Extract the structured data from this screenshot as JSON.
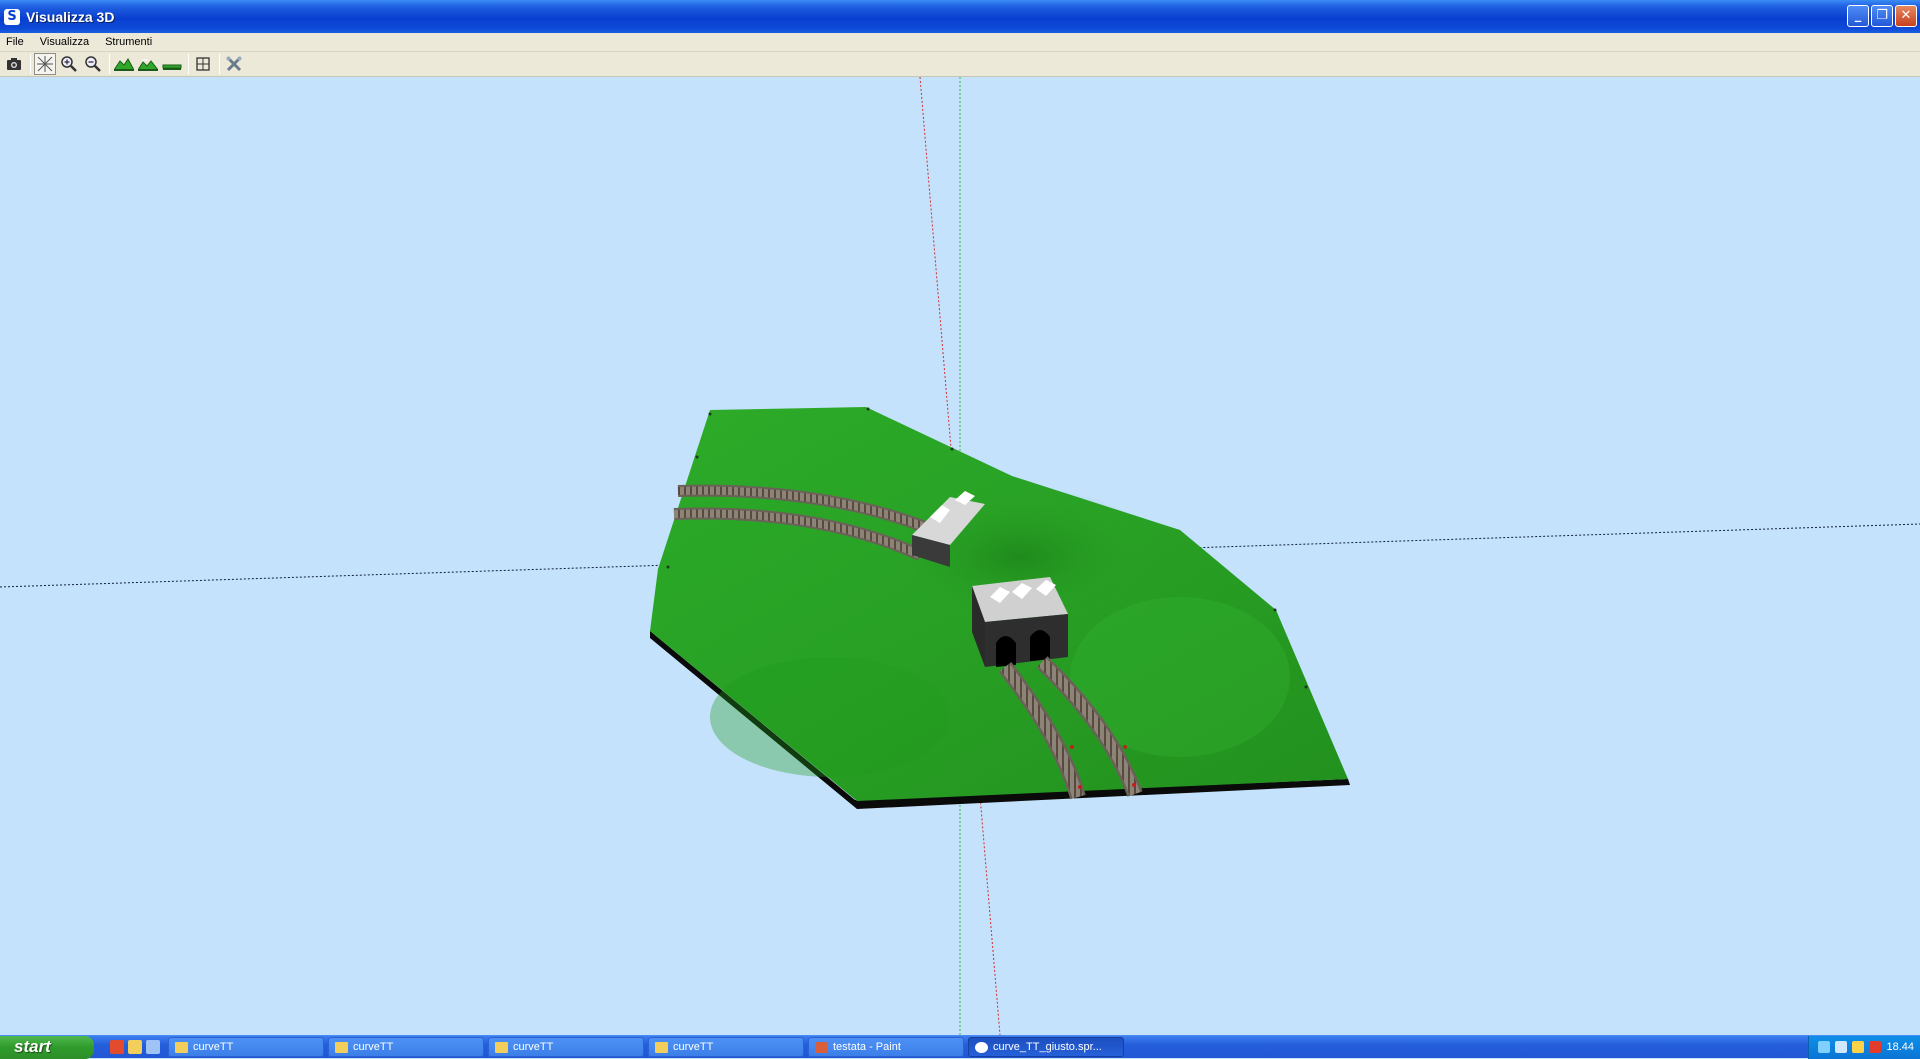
{
  "window": {
    "title": "Visualizza 3D",
    "app_icon": "S",
    "controls": [
      "minimize-icon",
      "restore-icon",
      "close-icon"
    ]
  },
  "menu": {
    "items": [
      {
        "label": "File"
      },
      {
        "label": "Visualizza"
      },
      {
        "label": "Strumenti"
      }
    ]
  },
  "toolbar": {
    "icons": [
      "camera-icon",
      "axes-icon",
      "zoom-in-icon",
      "zoom-out-icon",
      "terrain-raise-icon",
      "terrain-lower-icon",
      "terrain-flat-icon",
      "fit-view-icon",
      "tools-icon"
    ]
  },
  "taskbar": {
    "start_label": "start",
    "tasks": [
      {
        "label": "curveTT",
        "icon": "folder-icon"
      },
      {
        "label": "curveTT",
        "icon": "folder-icon"
      },
      {
        "label": "curveTT",
        "icon": "folder-icon"
      },
      {
        "label": "curveTT",
        "icon": "folder-icon"
      },
      {
        "label": "testata - Paint",
        "icon": "paint-icon"
      },
      {
        "label": "curve_TT_giusto.spr...",
        "icon": "app-icon"
      }
    ],
    "clock": "18.44"
  },
  "colors": {
    "sky": "#c4e2fc",
    "terrain": "#2fa82a",
    "titlebar": "#0a3fd1"
  }
}
